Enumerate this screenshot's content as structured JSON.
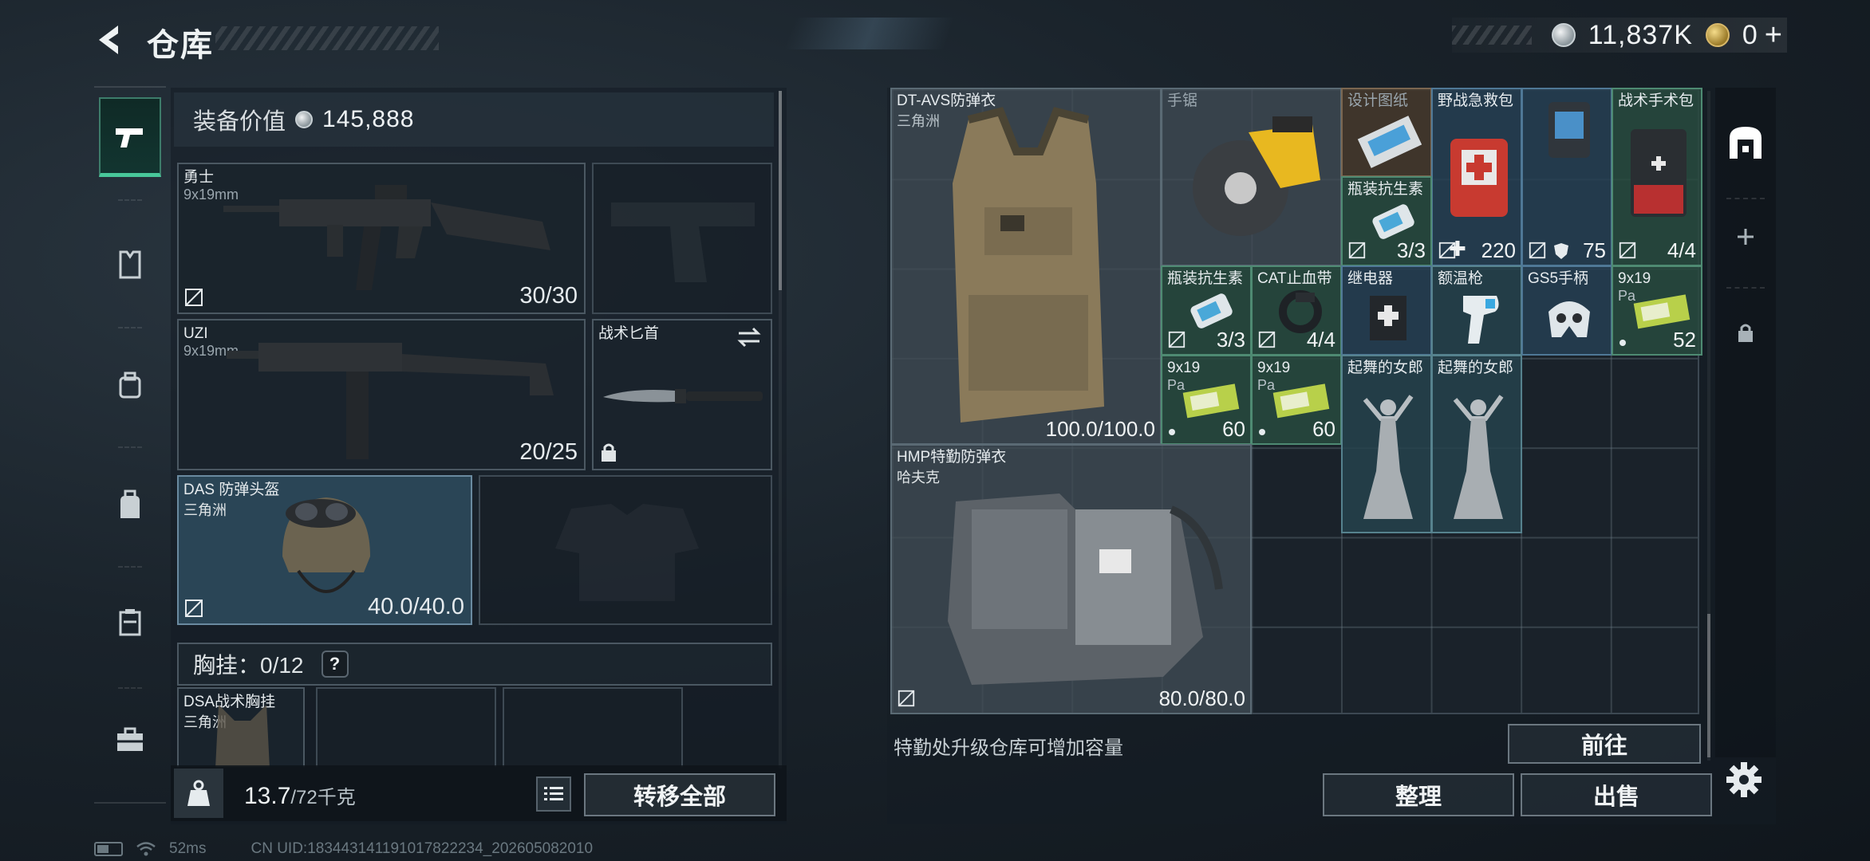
{
  "header": {
    "title": "仓库",
    "currency_silver": "11,837K",
    "currency_gold": "0",
    "add_symbol": "+"
  },
  "nav": {
    "items": [
      "weapons",
      "armor",
      "rig",
      "backpack",
      "case",
      "toolbox"
    ],
    "active": "weapons"
  },
  "equipment": {
    "value_label": "装备价值",
    "value": "145,888",
    "primary": {
      "name": "勇士",
      "ammo": "9x19mm",
      "count": "30/30"
    },
    "secondary": {
      "name": "UZI",
      "ammo": "9x19mm",
      "count": "20/25"
    },
    "knife": {
      "name": "战术匕首"
    },
    "helmet": {
      "name": "DAS 防弹头盔",
      "sub": "三角洲",
      "count": "40.0/40.0"
    },
    "chest_label": "胸挂：0/12",
    "help": "?",
    "rig": {
      "name": "DSA战术胸挂",
      "sub": "三角洲"
    },
    "weight_value": "13.7",
    "weight_unit": "/72千克",
    "transfer_all": "转移全部"
  },
  "warehouse": {
    "items": {
      "dt_avs": {
        "name": "DT-AVS防弹衣",
        "sub": "三角洲",
        "count": "100.0/100.0"
      },
      "saw": {
        "name": "手锯"
      },
      "blueprint": {
        "name": "设计图纸"
      },
      "firstaid": {
        "name": "野战急救包",
        "count": "220"
      },
      "device": {
        "count": "75"
      },
      "surgical": {
        "name": "战术手术包",
        "count": "4/4"
      },
      "antibiotic1": {
        "name": "瓶装抗生素",
        "count": "3/3"
      },
      "antibiotic2": {
        "name": "瓶装抗生素",
        "count": "3/3"
      },
      "cat": {
        "name": "CAT止血带",
        "count": "4/4"
      },
      "relay": {
        "name": "继电器"
      },
      "thermometer": {
        "name": "额温枪"
      },
      "gs5": {
        "name": "GS5手柄"
      },
      "ammo_top": {
        "name": "9x19",
        "sub": "Pa",
        "count": "52"
      },
      "ammo1": {
        "name": "9x19",
        "sub": "Pa",
        "count": "60"
      },
      "ammo2": {
        "name": "9x19",
        "sub": "Pa",
        "count": "60"
      },
      "dancer1": {
        "name": "起舞的女郎"
      },
      "dancer2": {
        "name": "起舞的女郎"
      },
      "hmp": {
        "name": "HMP特勤防弹衣",
        "sub": "哈夫克",
        "count": "80.0/80.0"
      }
    },
    "upgrade_text": "特勤处升级仓库可增加容量",
    "goto": "前往",
    "sort": "整理",
    "sell": "出售"
  },
  "status": {
    "ping": "52ms",
    "uid": "CN UID:18344314119101782223​4_202605082010"
  }
}
